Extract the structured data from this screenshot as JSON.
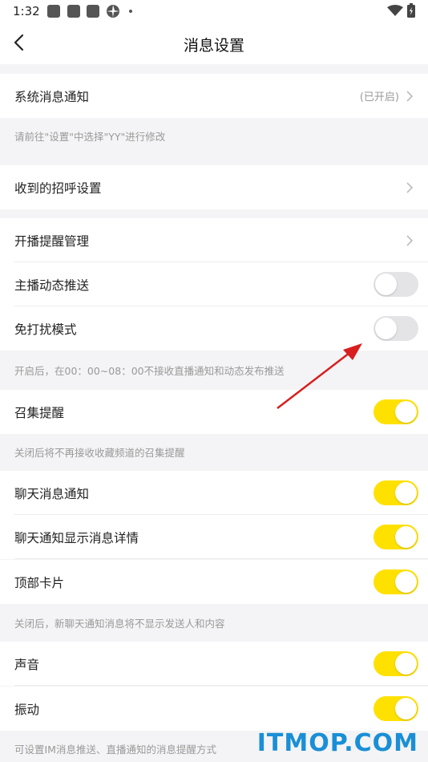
{
  "status_bar": {
    "time": "1:32"
  },
  "header": {
    "title": "消息设置"
  },
  "sections": {
    "system_notice": {
      "label": "系统消息通知",
      "status": "(已开启)"
    },
    "system_notice_note": "请前往\"设置\"中选择\"YY\"进行修改",
    "greeting": {
      "label": "收到的招呼设置"
    },
    "live_reminder": {
      "label": "开播提醒管理"
    },
    "streamer_feed": {
      "label": "主播动态推送",
      "enabled": false
    },
    "dnd_mode": {
      "label": "免打扰模式",
      "enabled": false
    },
    "dnd_note": "开启后，在00：00~08：00不接收直播通知和动态发布推送",
    "gather": {
      "label": "召集提醒",
      "enabled": true
    },
    "gather_note": "关闭后将不再接收收藏频道的召集提醒",
    "chat_notice": {
      "label": "聊天消息通知",
      "enabled": true
    },
    "chat_detail": {
      "label": "聊天通知显示消息详情",
      "enabled": true
    },
    "top_card": {
      "label": "顶部卡片",
      "enabled": true
    },
    "chat_note": "关闭后，新聊天通知消息将不显示发送人和内容",
    "sound": {
      "label": "声音",
      "enabled": true
    },
    "vibrate": {
      "label": "振动",
      "enabled": true
    },
    "alert_note": "可设置IM消息推送、直播通知的消息提醒方式"
  },
  "colors": {
    "toggle_on": "#ffe100",
    "toggle_off": "#e4e4e6",
    "annotation_arrow": "#d81e1e",
    "watermark": "#1a8fd6"
  },
  "watermark": "ITMOP.COM"
}
